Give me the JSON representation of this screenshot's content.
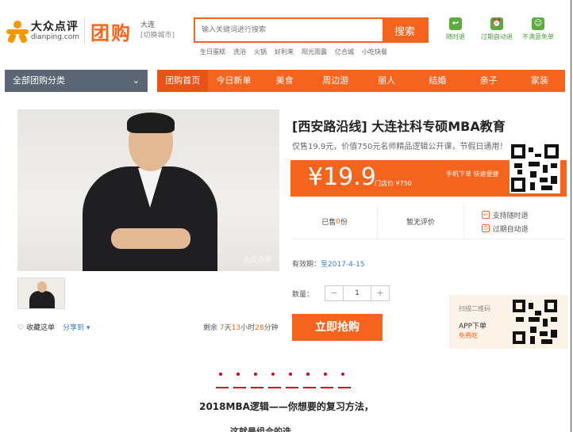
{
  "header": {
    "logo_cn": "大众点评",
    "logo_en": "dianping.com",
    "logo_tuangou": "团购",
    "city": "大连",
    "switch_city": "[切换城市]",
    "search_placeholder": "输入关键词进行搜索",
    "search_button": "搜索",
    "hotwords": [
      "生日蛋糕",
      "洗浴",
      "火锅",
      "好利来",
      "阳光雨露",
      "亿合城",
      "小吃快餐"
    ],
    "guarantees": [
      {
        "icon": "refund-anytime-icon",
        "label": "随时退"
      },
      {
        "icon": "expire-refund-icon",
        "label": "过期自动退"
      },
      {
        "icon": "unsatisfied-icon",
        "label": "不满意免单"
      }
    ]
  },
  "nav": {
    "categories_label": "全部团购分类",
    "tabs": [
      "团购首页",
      "今日新单",
      "美食",
      "周边游",
      "丽人",
      "结婚",
      "亲子",
      "家装"
    ],
    "active_tab": 0
  },
  "product": {
    "title": "[西安路沿线] 大连社科专硕MBA教育",
    "subtitle": "仅售19.9元，价值750元名师精品逻辑公开课，节假日通用！",
    "image_watermark": "大众点评",
    "price": "¥19.9",
    "original_price_label": "门店价 ¥750",
    "mobile_order": "手机下单 快速便捷",
    "sold": "已售",
    "sold_count": "0",
    "sold_unit": "份",
    "reviews": "暂无评价",
    "support_refund": "支持随时退",
    "expire_refund": "过期自动退",
    "validity_label": "有效期：",
    "validity_date": "至2017-4-15",
    "quantity_label": "数量：",
    "quantity_value": "1",
    "buy_button": "立即抢购",
    "favorite": "收藏这单",
    "share": "分享到",
    "remaining_prefix": "剩余",
    "remaining_days": "7",
    "remaining_days_unit": "天",
    "remaining_hours": "13",
    "remaining_hours_unit": "小时",
    "remaining_minutes": "28",
    "remaining_minutes_unit": "分钟"
  },
  "app_promo": {
    "scan": "扫描二维码",
    "download": "APP下单",
    "free": "免费吃"
  },
  "article": {
    "title": "2018MBA逻辑——你想要的复习方法，",
    "next_line": "这就是组合的选"
  },
  "colors": {
    "brand_orange": "#f5641e",
    "nav_gray": "#5b6675",
    "accent_red": "#d0021b",
    "link_blue": "#3b7bc2"
  }
}
